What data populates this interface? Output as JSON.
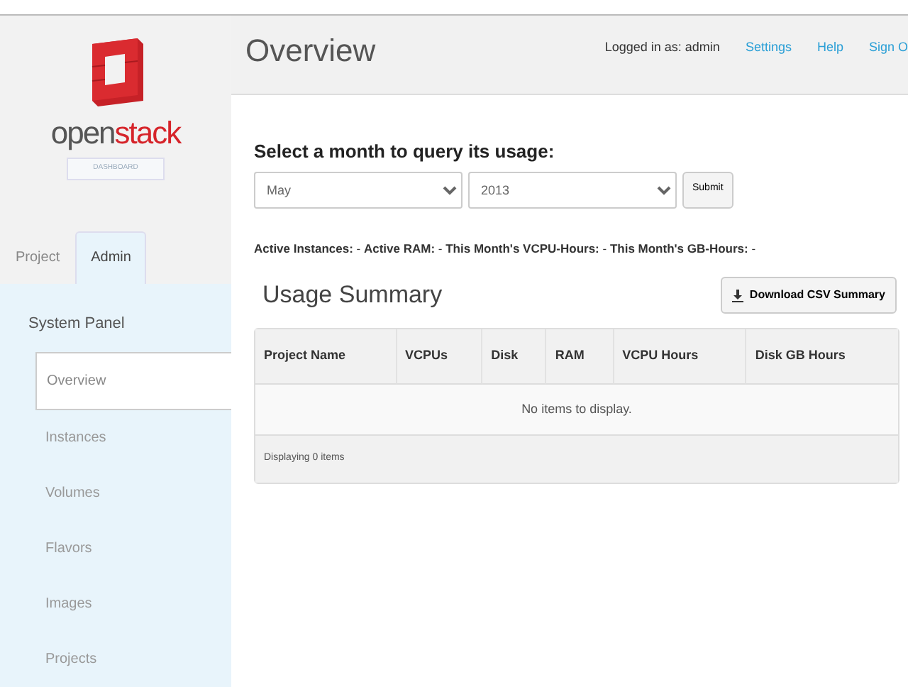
{
  "sidebar": {
    "logo": {
      "wordmark_dark": "open",
      "wordmark_red": "stack",
      "subtitle": "DASHBOARD"
    },
    "tabs": [
      {
        "label": "Project",
        "selected": false
      },
      {
        "label": "Admin",
        "selected": true
      }
    ],
    "panel_title": "System Panel",
    "items": [
      {
        "label": "Overview",
        "selected": true
      },
      {
        "label": "Instances",
        "selected": false
      },
      {
        "label": "Volumes",
        "selected": false
      },
      {
        "label": "Flavors",
        "selected": false
      },
      {
        "label": "Images",
        "selected": false
      },
      {
        "label": "Projects",
        "selected": false
      }
    ]
  },
  "header": {
    "title": "Overview",
    "logged_in": "Logged in as: admin",
    "links": [
      "Settings",
      "Help",
      "Sign O"
    ]
  },
  "query": {
    "heading": "Select a month to query its usage:",
    "month": "May",
    "year": "2013",
    "submit": "Submit"
  },
  "stats": "**Active Instances:** - **Active RAM:** - **This Month's VCPU-Hours:** - **This Month's GB-Hours:** -",
  "usage": {
    "title": "Usage Summary",
    "download": "Download CSV Summary",
    "columns": [
      "Project Name",
      "VCPUs",
      "Disk",
      "RAM",
      "VCPU Hours",
      "Disk GB Hours"
    ],
    "empty": "No items to display.",
    "footer": "Displaying 0 items"
  }
}
